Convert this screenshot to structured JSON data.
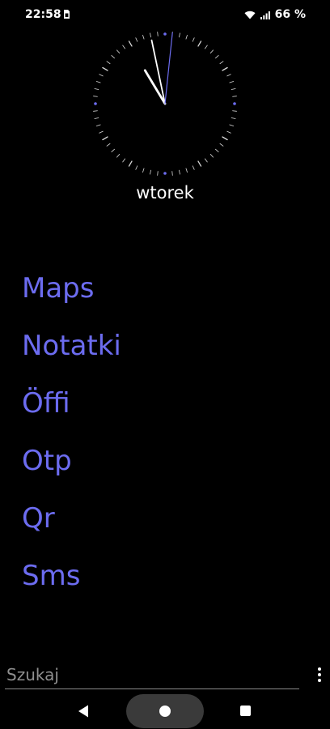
{
  "status_bar": {
    "time": "22:58",
    "battery": "66 %"
  },
  "clock": {
    "hour": 22,
    "minute": 58,
    "second": 1,
    "accent": "#6c6cf0"
  },
  "day_label": "wtorek",
  "apps": [
    {
      "label": "Maps"
    },
    {
      "label": "Notatki"
    },
    {
      "label": "Öffi"
    },
    {
      "label": "Otp"
    },
    {
      "label": "Qr"
    },
    {
      "label": "Sms"
    }
  ],
  "search": {
    "placeholder": "Szukaj",
    "value": ""
  },
  "icons": {
    "sim": "sim-card-icon",
    "wifi": "wifi-icon",
    "signal": "signal-icon",
    "menu": "more-vert-icon",
    "back": "back-icon",
    "home": "home-icon",
    "recents": "recents-icon"
  }
}
